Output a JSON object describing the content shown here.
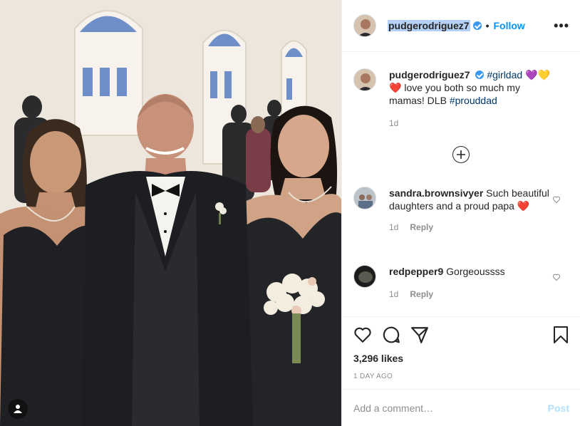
{
  "header": {
    "username": "pudgerodriguez7",
    "separator": "•",
    "follow_label": "Follow",
    "more_label": "•••"
  },
  "caption": {
    "username": "pudgerodriguez7",
    "hashtag1": "#girldad",
    "emoji1": "💜💛",
    "emoji2": "❤️",
    "text": "love you both so much my mamas! DLB",
    "hashtag2": "#prouddad",
    "time": "1d"
  },
  "comments": [
    {
      "username": "sandra.brownsivyer",
      "text": "Such beautiful daughters and a proud papa",
      "emoji": "❤️",
      "time": "1d",
      "reply_label": "Reply"
    },
    {
      "username": "redpepper9",
      "text": "Gorgeoussss",
      "time": "1d",
      "reply_label": "Reply"
    }
  ],
  "likes": "3,296 likes",
  "date": "1 DAY AGO",
  "add_comment": {
    "placeholder": "Add a comment…",
    "post_label": "Post"
  },
  "icons": [
    "user-tag-icon",
    "heart-icon",
    "comment-icon",
    "share-icon",
    "bookmark-icon",
    "plus-circle-icon",
    "more-icon",
    "verified-icon"
  ],
  "colors": {
    "link": "#0095f6",
    "hashtag": "#00376b",
    "post_disabled": "#b2dffc",
    "verified": "#3897f0"
  }
}
